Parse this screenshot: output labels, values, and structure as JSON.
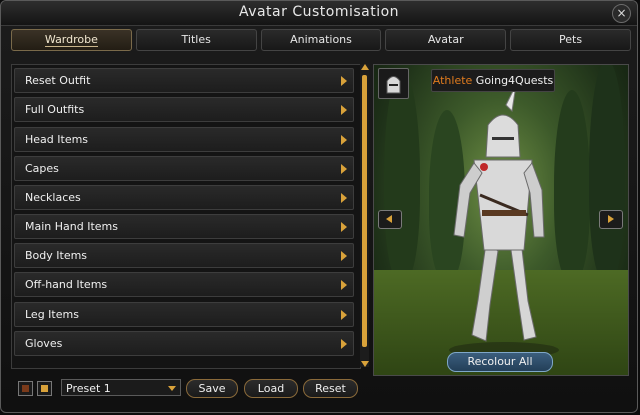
{
  "window": {
    "title": "Avatar Customisation"
  },
  "tabs": [
    {
      "label": "Wardrobe",
      "active": true
    },
    {
      "label": "Titles",
      "active": false
    },
    {
      "label": "Animations",
      "active": false
    },
    {
      "label": "Avatar",
      "active": false
    },
    {
      "label": "Pets",
      "active": false
    }
  ],
  "wardrobe": {
    "items": [
      "Reset Outfit",
      "Full Outfits",
      "Head Items",
      "Capes",
      "Necklaces",
      "Main Hand Items",
      "Body Items",
      "Off-hand Items",
      "Leg Items",
      "Gloves"
    ]
  },
  "preview": {
    "title": "Athlete",
    "username": "Going4Quests",
    "recolour_label": "Recolour All"
  },
  "bottom": {
    "preset_value": "Preset 1",
    "save_label": "Save",
    "load_label": "Load",
    "reset_label": "Reset"
  },
  "colors": {
    "accent": "#d9a23a",
    "title_orange": "#e07b1e"
  },
  "icons": [
    "close-icon",
    "arrow-right-icon",
    "helmet-icon",
    "rotate-left-icon",
    "rotate-right-icon",
    "dropdown-icon"
  ]
}
